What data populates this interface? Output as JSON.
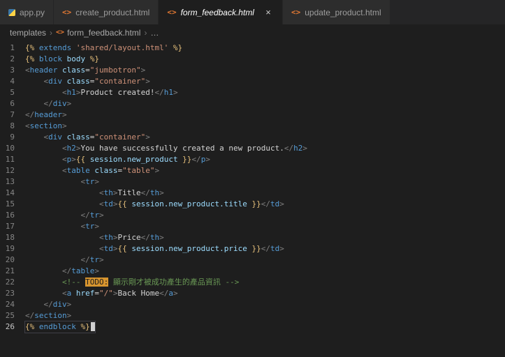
{
  "icons": {
    "html_glyph": "<>",
    "close_glyph": "×",
    "breadcrumb_separator": "›"
  },
  "colors": {
    "background": "#1e1e1e",
    "tab_active_bg": "#1e1e1e",
    "tab_inactive_bg": "#2d2d2d",
    "html_icon": "#e37933",
    "todo_highlight": "#d7952f"
  },
  "tab_bar": {
    "tabs": [
      {
        "label": "app.py",
        "icon": "python",
        "active": false
      },
      {
        "label": "create_product.html",
        "icon": "html",
        "active": false
      },
      {
        "label": "form_feedback.html",
        "icon": "html",
        "active": true
      },
      {
        "label": "update_product.html",
        "icon": "html",
        "active": false
      }
    ]
  },
  "breadcrumb": {
    "items": [
      {
        "label": "templates"
      },
      {
        "label": "form_feedback.html",
        "icon": "html"
      },
      {
        "label": "…"
      }
    ]
  },
  "editor": {
    "lines": [
      {
        "tokens": [
          [
            "jd",
            "{%"
          ],
          [
            "kw",
            " extends"
          ],
          [
            "str",
            " 'shared/layout.html'"
          ],
          [
            "jd",
            " %}"
          ]
        ]
      },
      {
        "tokens": [
          [
            "jd",
            "{%"
          ],
          [
            "kw",
            " block"
          ],
          [
            "var",
            " body"
          ],
          [
            "jd",
            " %}"
          ]
        ]
      },
      {
        "tokens": [
          [
            "pb",
            "<"
          ],
          [
            "tag",
            "header"
          ],
          [
            "attr",
            " class"
          ],
          [
            "op",
            "="
          ],
          [
            "str",
            "\"jumbotron\""
          ],
          [
            "pb",
            ">"
          ]
        ]
      },
      {
        "tokens": [
          [
            "pb",
            "    <"
          ],
          [
            "tag",
            "div"
          ],
          [
            "attr",
            " class"
          ],
          [
            "op",
            "="
          ],
          [
            "str",
            "\"container\""
          ],
          [
            "pb",
            ">"
          ]
        ]
      },
      {
        "tokens": [
          [
            "pb",
            "        <"
          ],
          [
            "tag",
            "h1"
          ],
          [
            "pb",
            ">"
          ],
          [
            "txt",
            "Product created!"
          ],
          [
            "pb",
            "</"
          ],
          [
            "tag",
            "h1"
          ],
          [
            "pb",
            ">"
          ]
        ]
      },
      {
        "tokens": [
          [
            "pb",
            "    </"
          ],
          [
            "tag",
            "div"
          ],
          [
            "pb",
            ">"
          ]
        ]
      },
      {
        "tokens": [
          [
            "pb",
            "</"
          ],
          [
            "tag",
            "header"
          ],
          [
            "pb",
            ">"
          ]
        ]
      },
      {
        "tokens": [
          [
            "pb",
            "<"
          ],
          [
            "tag",
            "section"
          ],
          [
            "pb",
            ">"
          ]
        ]
      },
      {
        "tokens": [
          [
            "pb",
            "    <"
          ],
          [
            "tag",
            "div"
          ],
          [
            "attr",
            " class"
          ],
          [
            "op",
            "="
          ],
          [
            "str",
            "\"container\""
          ],
          [
            "pb",
            ">"
          ]
        ]
      },
      {
        "tokens": [
          [
            "pb",
            "        <"
          ],
          [
            "tag",
            "h2"
          ],
          [
            "pb",
            ">"
          ],
          [
            "txt",
            "You have successfully created a new product."
          ],
          [
            "pb",
            "</"
          ],
          [
            "tag",
            "h2"
          ],
          [
            "pb",
            ">"
          ]
        ]
      },
      {
        "tokens": [
          [
            "pb",
            "        <"
          ],
          [
            "tag",
            "p"
          ],
          [
            "pb",
            ">"
          ],
          [
            "jd",
            "{{"
          ],
          [
            "var",
            " session.new_product"
          ],
          [
            "jd",
            " }}"
          ],
          [
            "pb",
            "</"
          ],
          [
            "tag",
            "p"
          ],
          [
            "pb",
            ">"
          ]
        ]
      },
      {
        "tokens": [
          [
            "pb",
            "        <"
          ],
          [
            "tag",
            "table"
          ],
          [
            "attr",
            " class"
          ],
          [
            "op",
            "="
          ],
          [
            "str",
            "\"table\""
          ],
          [
            "pb",
            ">"
          ]
        ]
      },
      {
        "tokens": [
          [
            "pb",
            "            <"
          ],
          [
            "tag",
            "tr"
          ],
          [
            "pb",
            ">"
          ]
        ]
      },
      {
        "tokens": [
          [
            "pb",
            "                <"
          ],
          [
            "tag",
            "th"
          ],
          [
            "pb",
            ">"
          ],
          [
            "txt",
            "Title"
          ],
          [
            "pb",
            "</"
          ],
          [
            "tag",
            "th"
          ],
          [
            "pb",
            ">"
          ]
        ]
      },
      {
        "tokens": [
          [
            "pb",
            "                <"
          ],
          [
            "tag",
            "td"
          ],
          [
            "pb",
            ">"
          ],
          [
            "jd",
            "{{"
          ],
          [
            "var",
            " session.new_product.title"
          ],
          [
            "jd",
            " }}"
          ],
          [
            "pb",
            "</"
          ],
          [
            "tag",
            "td"
          ],
          [
            "pb",
            ">"
          ]
        ]
      },
      {
        "tokens": [
          [
            "pb",
            "            </"
          ],
          [
            "tag",
            "tr"
          ],
          [
            "pb",
            ">"
          ]
        ]
      },
      {
        "tokens": [
          [
            "pb",
            "            <"
          ],
          [
            "tag",
            "tr"
          ],
          [
            "pb",
            ">"
          ]
        ]
      },
      {
        "tokens": [
          [
            "pb",
            "                <"
          ],
          [
            "tag",
            "th"
          ],
          [
            "pb",
            ">"
          ],
          [
            "txt",
            "Price"
          ],
          [
            "pb",
            "</"
          ],
          [
            "tag",
            "th"
          ],
          [
            "pb",
            ">"
          ]
        ]
      },
      {
        "tokens": [
          [
            "pb",
            "                <"
          ],
          [
            "tag",
            "td"
          ],
          [
            "pb",
            ">"
          ],
          [
            "jd",
            "{{"
          ],
          [
            "var",
            " session.new_product.price"
          ],
          [
            "jd",
            " }}"
          ],
          [
            "pb",
            "</"
          ],
          [
            "tag",
            "td"
          ],
          [
            "pb",
            ">"
          ]
        ]
      },
      {
        "tokens": [
          [
            "pb",
            "            </"
          ],
          [
            "tag",
            "tr"
          ],
          [
            "pb",
            ">"
          ]
        ]
      },
      {
        "tokens": [
          [
            "pb",
            "        </"
          ],
          [
            "tag",
            "table"
          ],
          [
            "pb",
            ">"
          ]
        ]
      },
      {
        "tokens": [
          [
            "com",
            "        <!-- "
          ],
          [
            "todo",
            "TODO:"
          ],
          [
            "com",
            " 顯示剛才被成功產生的產品資訊 -->"
          ]
        ]
      },
      {
        "tokens": [
          [
            "pb",
            "        <"
          ],
          [
            "tag",
            "a"
          ],
          [
            "attr",
            " href"
          ],
          [
            "op",
            "="
          ],
          [
            "str",
            "\"/\""
          ],
          [
            "pb",
            ">"
          ],
          [
            "txt",
            "Back Home"
          ],
          [
            "pb",
            "</"
          ],
          [
            "tag",
            "a"
          ],
          [
            "pb",
            ">"
          ]
        ]
      },
      {
        "tokens": [
          [
            "pb",
            "    </"
          ],
          [
            "tag",
            "div"
          ],
          [
            "pb",
            ">"
          ]
        ]
      },
      {
        "tokens": [
          [
            "pb",
            "</"
          ],
          [
            "tag",
            "section"
          ],
          [
            "pb",
            ">"
          ]
        ]
      },
      {
        "tokens": [
          [
            "jd",
            "{%"
          ],
          [
            "kw",
            " endblock"
          ],
          [
            "jd",
            " %}"
          ]
        ],
        "cursor": true,
        "current": true
      }
    ]
  }
}
